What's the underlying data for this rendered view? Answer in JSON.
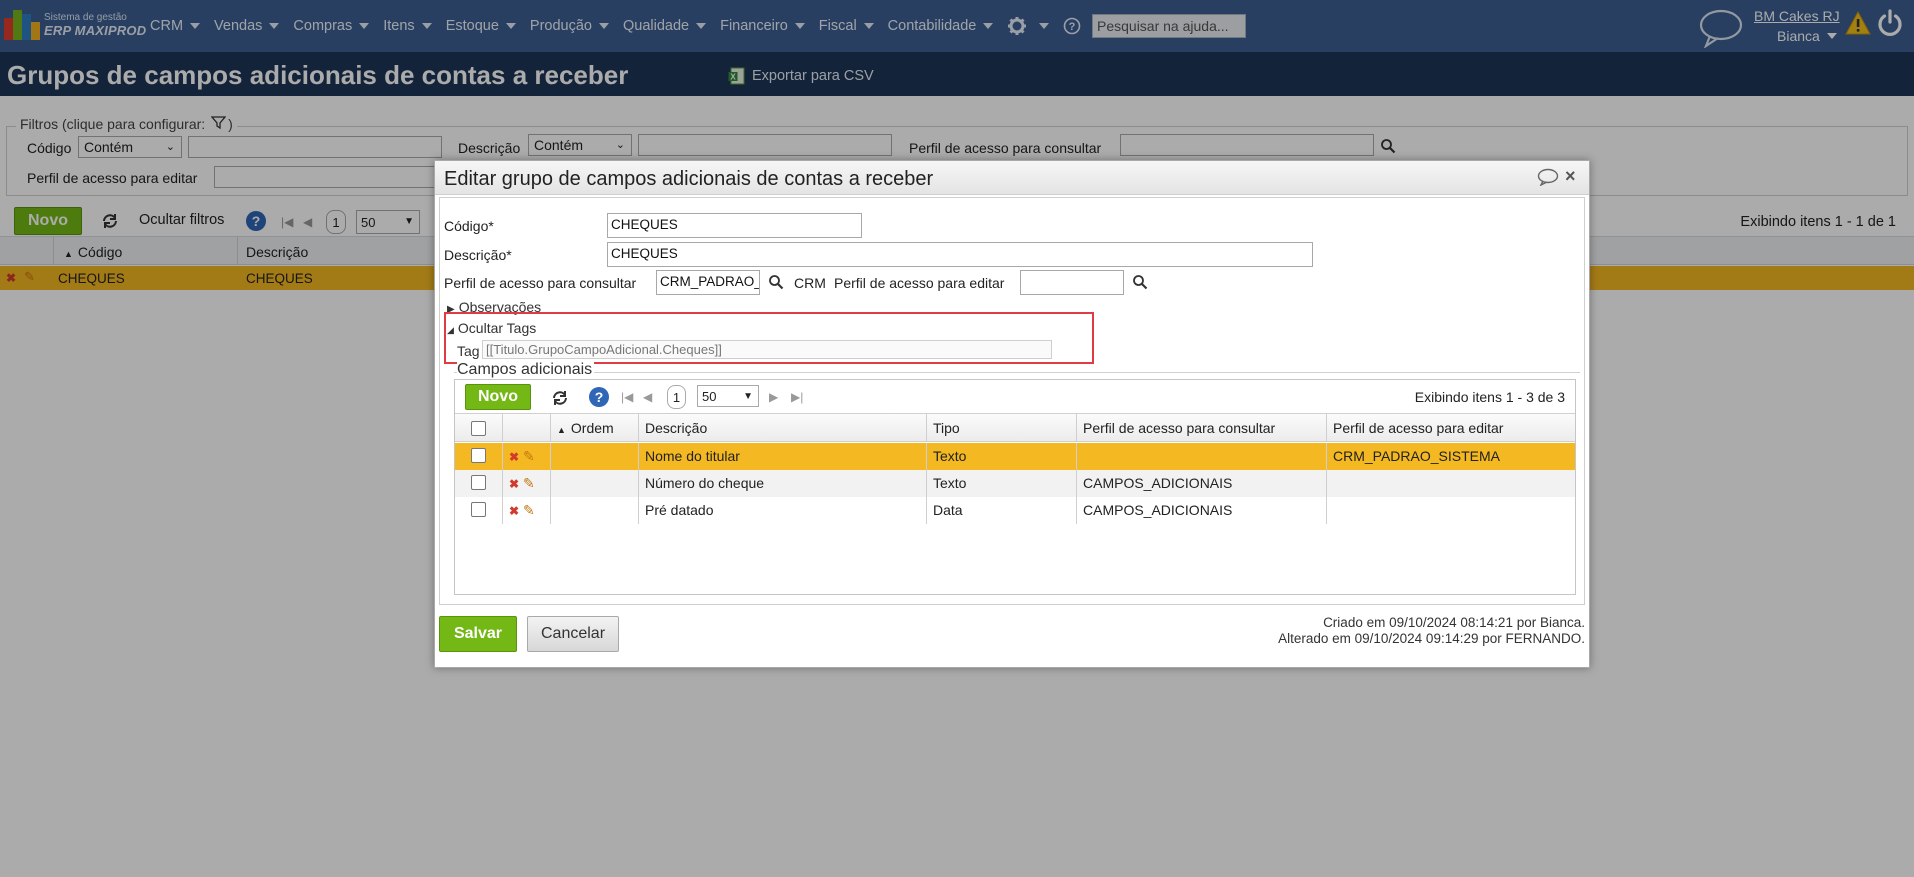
{
  "topbar": {
    "brand_small": "Sistema de gestão",
    "brand_big": "ERP MAXIPROD",
    "menu": [
      "CRM",
      "Vendas",
      "Compras",
      "Itens",
      "Estoque",
      "Produção",
      "Qualidade",
      "Financeiro",
      "Fiscal",
      "Contabilidade"
    ],
    "help_search_placeholder": "Pesquisar na ajuda...",
    "company": "BM Cakes RJ",
    "user": "Bianca",
    "icons": [
      "gear-icon",
      "question-icon",
      "chat-icon",
      "warning-icon",
      "power-icon"
    ],
    "colors": {
      "bar": "#3d5f93",
      "header": "#1d3557"
    }
  },
  "page": {
    "title": "Grupos de campos adicionais de contas a receber",
    "export_label": "Exportar para CSV"
  },
  "filters": {
    "legend": "Filtros (clique para configurar:",
    "legend_end": ")",
    "codigo_label": "Código",
    "codigo_op": "Contém",
    "descricao_label": "Descrição",
    "descricao_op": "Contém",
    "perfil_consultar_label": "Perfil de acesso para consultar",
    "perfil_editar_label": "Perfil de acesso para editar"
  },
  "list": {
    "novo": "Novo",
    "hide_filters": "Ocultar filtros",
    "page": "1",
    "page_size": "50",
    "showing": "Exibindo itens 1 - 1 de 1",
    "columns": [
      "Código",
      "Descrição"
    ],
    "rows": [
      {
        "codigo": "CHEQUES",
        "descricao": "CHEQUES"
      }
    ]
  },
  "modal": {
    "title": "Editar grupo de campos adicionais de contas a receber",
    "codigo_label": "Código*",
    "codigo_value": "CHEQUES",
    "descricao_label": "Descrição*",
    "descricao_value": "CHEQUES",
    "perfil_consultar_label": "Perfil de acesso para consultar",
    "perfil_consultar_value": "CRM_PADRAO_SISTEMA",
    "perfil_consultar_suffix": "CRM",
    "perfil_editar_label": "Perfil de acesso para editar",
    "perfil_editar_value": "",
    "observacoes": "Observações",
    "ocultar_tags": "Ocultar Tags",
    "tag_label": "Tag",
    "tag_value": "[[Titulo.GrupoCampoAdicional.Cheques]]",
    "subsection_title": "Campos adicionais",
    "sub_novo": "Novo",
    "sub_page": "1",
    "sub_page_size": "50",
    "sub_showing": "Exibindo itens 1 - 3 de 3",
    "sub_columns": [
      "Ordem",
      "Descrição",
      "Tipo",
      "Perfil de acesso para consultar",
      "Perfil de acesso para editar"
    ],
    "sub_rows": [
      {
        "ordem": "",
        "descricao": "Nome do titular",
        "tipo": "Texto",
        "consultar": "",
        "editar": "CRM_PADRAO_SISTEMA",
        "selected": true
      },
      {
        "ordem": "",
        "descricao": "Número do cheque",
        "tipo": "Texto",
        "consultar": "CAMPOS_ADICIONAIS",
        "editar": "",
        "selected": false
      },
      {
        "ordem": "",
        "descricao": "Pré datado",
        "tipo": "Data",
        "consultar": "CAMPOS_ADICIONAIS",
        "editar": "",
        "selected": false
      }
    ],
    "salvar": "Salvar",
    "cancelar": "Cancelar",
    "criado": "Criado em 09/10/2024 08:14:21 por Bianca.",
    "alterado": "Alterado em 09/10/2024 09:14:29 por FERNANDO.",
    "colors": {
      "selected_row": "#f4b822",
      "alt_row": "#f2f2f2",
      "green": "#74b816",
      "highlight_box": "#e03a45"
    }
  }
}
